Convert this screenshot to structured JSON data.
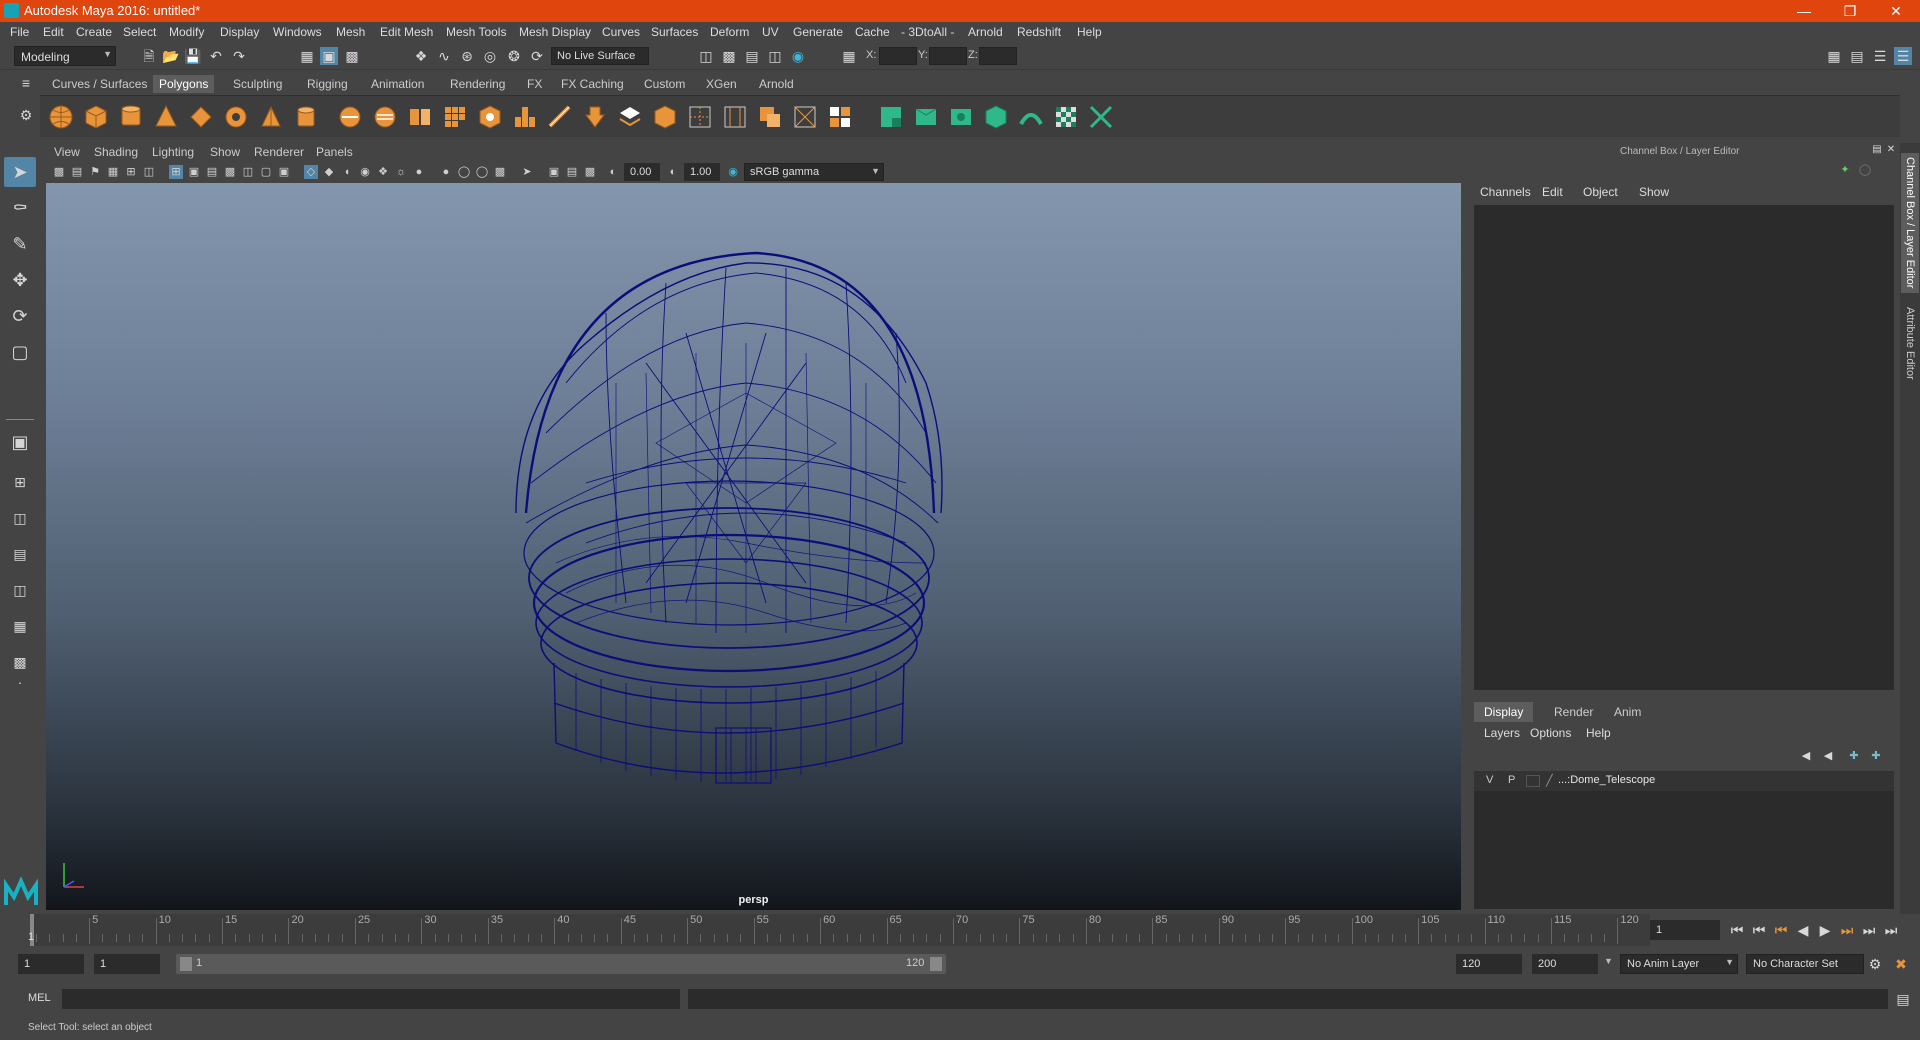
{
  "window": {
    "title": "Autodesk Maya 2016: untitled*"
  },
  "menubar": {
    "items": [
      "File",
      "Edit",
      "Create",
      "Select",
      "Modify",
      "Display",
      "Windows",
      "Mesh",
      "Edit Mesh",
      "Mesh Tools",
      "Mesh Display",
      "Curves",
      "Surfaces",
      "Deform",
      "UV",
      "Generate",
      "Cache",
      "- 3DtoAll -",
      "Arnold",
      "Redshift",
      "Help"
    ]
  },
  "statusline": {
    "mode": "Modeling",
    "live_surface": "No Live Surface",
    "x_label": "X:",
    "y_label": "Y:",
    "z_label": "Z:"
  },
  "shelf": {
    "tabs": [
      "Curves / Surfaces",
      "Polygons",
      "Sculpting",
      "Rigging",
      "Animation",
      "Rendering",
      "FX",
      "FX Caching",
      "Custom",
      "XGen",
      "Arnold"
    ],
    "active_tab": "Polygons"
  },
  "viewport": {
    "menus": [
      "View",
      "Shading",
      "Lighting",
      "Show",
      "Renderer",
      "Panels"
    ],
    "exposure": "0.00",
    "gamma": "1.00",
    "color_space": "sRGB gamma",
    "camera": "persp"
  },
  "channel_box": {
    "title": "Channel Box / Layer Editor",
    "menus": [
      "Channels",
      "Edit",
      "Object",
      "Show"
    ]
  },
  "layer_editor": {
    "tabs": [
      "Display",
      "Render",
      "Anim"
    ],
    "active_tab": "Display",
    "menus": [
      "Layers",
      "Options",
      "Help"
    ],
    "layers": [
      {
        "visible": "V",
        "playback": "P",
        "name": "...:Dome_Telescope"
      }
    ]
  },
  "side_tabs": [
    "Channel Box / Layer Editor",
    "Attribute Editor"
  ],
  "timeline": {
    "ticks": [
      "5",
      "10",
      "15",
      "20",
      "25",
      "30",
      "35",
      "40",
      "45",
      "50",
      "55",
      "60",
      "65",
      "70",
      "75",
      "80",
      "85",
      "90",
      "95",
      "100",
      "105",
      "110",
      "115",
      "120"
    ],
    "start_marker": "1",
    "current_frame": "1"
  },
  "range": {
    "start": "1",
    "playback_start": "1",
    "slider_start": "1",
    "slider_end": "120",
    "playback_end": "120",
    "end": "200",
    "anim_layer": "No Anim Layer",
    "character_set": "No Character Set"
  },
  "command_line": {
    "label": "MEL"
  },
  "help_line": {
    "text": "Select Tool: select an object"
  },
  "colors": {
    "title_bar": "#e0450e",
    "accent": "#5285a6",
    "wireframe": "#0d0d7a"
  }
}
